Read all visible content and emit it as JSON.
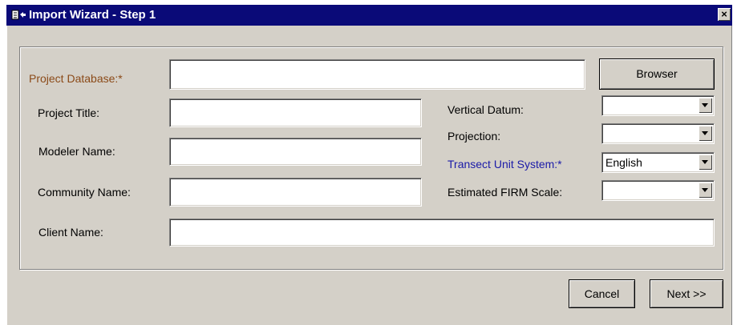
{
  "window": {
    "title": "Import Wizard - Step 1",
    "close_glyph": "×",
    "icon": "import-wizard-icon"
  },
  "form": {
    "project_database": {
      "label": "Project Database:*",
      "value": ""
    },
    "browse_button": "Browser",
    "project_title": {
      "label": "Project Title:",
      "value": ""
    },
    "modeler_name": {
      "label": "Modeler Name:",
      "value": ""
    },
    "community_name": {
      "label": "Community Name:",
      "value": ""
    },
    "client_name": {
      "label": "Client Name:",
      "value": ""
    },
    "vertical_datum": {
      "label": "Vertical Datum:",
      "value": ""
    },
    "projection": {
      "label": "Projection:",
      "value": ""
    },
    "transect_unit_system": {
      "label": "Transect Unit System:*",
      "value": "English"
    },
    "estimated_firm_scale": {
      "label": "Estimated FIRM Scale:",
      "value": ""
    }
  },
  "buttons": {
    "cancel": "Cancel",
    "next": "Next >>"
  },
  "colors": {
    "titlebar": "#0a0a78",
    "dialog_face": "#d4d0c8",
    "required_brown": "#8b4a18",
    "required_blue": "#1a1aa8"
  }
}
